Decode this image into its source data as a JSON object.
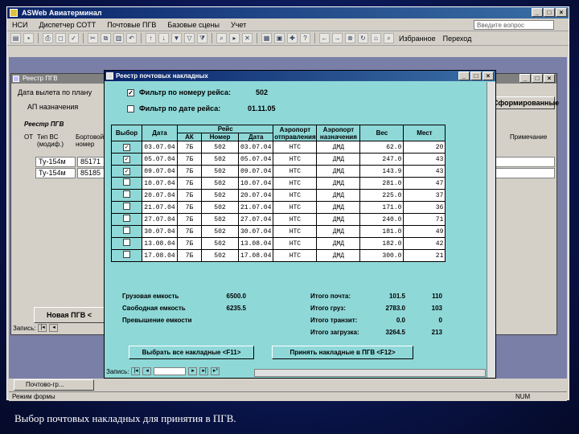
{
  "app": {
    "title": "ASWeb Авиатерминал",
    "menu": [
      "НСИ",
      "Диспетчер СОТТ",
      "Почтовые ПГВ",
      "Базовые сцены",
      "Учет"
    ],
    "help_placeholder": "Введите вопрос",
    "toolbar_text": [
      "Избранное",
      "Переход"
    ]
  },
  "pgv_window": {
    "title": "Реестр ПГВ",
    "date_label": "Дата вылета по плану",
    "dest_label": "АП назначения",
    "section_label": "Реестр ПГВ",
    "headers": [
      "ОТ",
      "Тип ВС (модиф.)",
      "Бортовой номер"
    ],
    "note_header": "Примечание",
    "rows": [
      {
        "type": "Ту-154м",
        "board": "85171"
      },
      {
        "type": "Ту-154м",
        "board": "85185"
      }
    ],
    "side_button": "Сформированные",
    "new_button": "Новая ПГВ <",
    "records_label": "Запись:"
  },
  "dialog": {
    "title": "Реестр почтовых накладных",
    "filter_flight": {
      "label": "Фильтр по номеру рейса:",
      "value": "502",
      "checked": true
    },
    "filter_date": {
      "label": "Фильтр по дате рейса:",
      "value": "01.11.05",
      "checked": false
    },
    "headers": {
      "select": "Выбор",
      "date": "Дата",
      "flight": "Рейс",
      "ak": "АК",
      "number": "Номер",
      "fdate": "Дата",
      "ap_dep": "Аэропорт отправления",
      "ap_arr": "Аэропорт назначения",
      "weight": "Вес",
      "places": "Мест"
    },
    "rows": [
      {
        "checked": true,
        "date": "03.07.04",
        "ak": "7Б",
        "num": "502",
        "fdate": "03.07.04",
        "dep": "НТС",
        "arr": "ДМД",
        "weight": "62.0",
        "places": "20"
      },
      {
        "checked": true,
        "date": "05.07.04",
        "ak": "7Б",
        "num": "502",
        "fdate": "05.07.04",
        "dep": "НТС",
        "arr": "ДМД",
        "weight": "247.0",
        "places": "43"
      },
      {
        "checked": true,
        "date": "09.07.04",
        "ak": "7Б",
        "num": "502",
        "fdate": "09.07.04",
        "dep": "НТС",
        "arr": "ДМД",
        "weight": "143.9",
        "places": "43"
      },
      {
        "checked": false,
        "date": "10.07.04",
        "ak": "7Б",
        "num": "502",
        "fdate": "10.07.04",
        "dep": "НТС",
        "arr": "ДМД",
        "weight": "281.0",
        "places": "47"
      },
      {
        "checked": false,
        "date": "20.07.04",
        "ak": "7Б",
        "num": "502",
        "fdate": "20.07.04",
        "dep": "НТС",
        "arr": "ДМД",
        "weight": "225.0",
        "places": "37"
      },
      {
        "checked": false,
        "date": "21.07.04",
        "ak": "7Б",
        "num": "502",
        "fdate": "21.07.04",
        "dep": "НТС",
        "arr": "ДМД",
        "weight": "171.0",
        "places": "36"
      },
      {
        "checked": false,
        "date": "27.07.04",
        "ak": "7Б",
        "num": "502",
        "fdate": "27.07.04",
        "dep": "НТС",
        "arr": "ДМД",
        "weight": "240.0",
        "places": "71"
      },
      {
        "checked": false,
        "date": "30.07.04",
        "ak": "7Б",
        "num": "502",
        "fdate": "30.07.04",
        "dep": "НТС",
        "arr": "ДМД",
        "weight": "181.0",
        "places": "49"
      },
      {
        "checked": false,
        "date": "13.08.04",
        "ak": "7Б",
        "num": "502",
        "fdate": "13.08.04",
        "dep": "НТС",
        "arr": "ДМД",
        "weight": "182.0",
        "places": "42"
      },
      {
        "checked": false,
        "date": "17.08.04",
        "ak": "7Б",
        "num": "502",
        "fdate": "17.08.04",
        "dep": "НТС",
        "arr": "ДМД",
        "weight": "300.0",
        "places": "21"
      }
    ],
    "summary_left": [
      {
        "label": "Грузовая емкость",
        "value": "6500.0"
      },
      {
        "label": "Свободная емкость",
        "value": "6235.5"
      },
      {
        "label": "Превышение емкости",
        "value": ""
      }
    ],
    "summary_right": [
      {
        "label": "Итого почта:",
        "weight": "101.5",
        "count": "110"
      },
      {
        "label": "Итого груз:",
        "weight": "2783.0",
        "count": "103"
      },
      {
        "label": "Итого транзит:",
        "weight": "0.0",
        "count": "0"
      },
      {
        "label": "Итого загрузка:",
        "weight": "3264.5",
        "count": "213"
      }
    ],
    "btn_select_all": "Выбрать все накладные <F11>",
    "btn_accept": "Принять накладные в ПГВ <F12>",
    "records_label": "Запись:"
  },
  "taskbar_item": "Почтово-гр...",
  "status": {
    "left": "Режим формы",
    "right": "NUM"
  },
  "caption": "Выбор почтовых накладных для принятия в ПГВ."
}
